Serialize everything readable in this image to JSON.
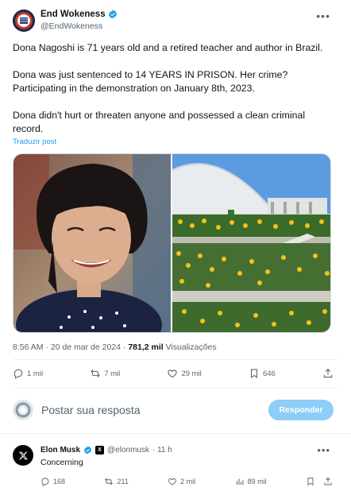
{
  "post": {
    "author_name": "End Wokeness",
    "author_handle": "@EndWokeness",
    "paragraphs": [
      "Dona Nagoshi is 71 years old and a retired teacher and author in Brazil.",
      "Dona was just sentenced to 14 YEARS IN PRISON. Her crime? Participating in the demonstration on January 8th, 2023.",
      "Dona didn't hurt or threaten anyone and possessed a clean criminal record."
    ],
    "translate_label": "Traduzir post",
    "timestamp": "8:56 AM · 20 de mar de 2024 · ",
    "views_count": "781,2 mil",
    "views_label": " Visualizações",
    "replies": "1 mil",
    "reposts": "7 mil",
    "likes": "29 mil",
    "bookmarks": "646"
  },
  "reply_box": {
    "placeholder": "Postar sua resposta",
    "button_label": "Responder"
  },
  "comment": {
    "author_name": "Elon Musk",
    "author_handle": "@elonmusk",
    "time": "· 11 h",
    "text": "Concerning",
    "replies": "168",
    "reposts": "211",
    "likes": "2 mil",
    "views": "89 mil"
  },
  "colors": {
    "accent": "#1d9bf0",
    "reply_button": "#8ecdf7",
    "muted": "#536471"
  },
  "icons": [
    "verified-badge-icon",
    "more-icon",
    "reply-icon",
    "repost-icon",
    "like-icon",
    "bookmark-icon",
    "share-icon",
    "views-icon",
    "x-logo-icon"
  ]
}
